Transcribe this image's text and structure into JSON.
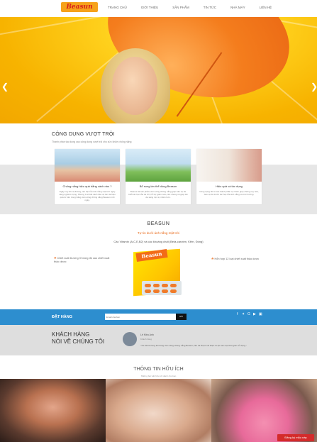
{
  "header": {
    "logo": "Beasun",
    "nav": [
      "TRANG CHỦ",
      "GIỚI THIỆU",
      "SẢN PHẨM",
      "TIN TỨC",
      "NHÀ MÁY",
      "LIÊN HỆ"
    ]
  },
  "hero": {
    "prev_icon": "chevron-left-icon",
    "next_icon": "chevron-right-icon"
  },
  "benefits": {
    "title": "CÔNG DỤNG VƯỢT TRỘI",
    "subtitle": "Thành phần tác dụng cao công dụng vượt trội cho sức khỏe chống nắng",
    "cards": [
      {
        "title": "Chống nắng hiệu quả bằng cách nào ?",
        "body": "Ngày nay khi ra đường, tác hại của ánh nắng mặt trời ngày càng nghiêm trọng. Nhưng ít ai biết cách bảo vệ làn da hiệu quả từ bên trong bằng viên uống chống nắng Beasun mỗi ngày."
      },
      {
        "title": "Bổ sung làn thể dùng Beasun",
        "body": "Beasun là sản phẩm viên uống chống nắng giúp bảo vệ da khỏi tác hại của tia UV, hỗ trợ giảm nám, tàn nhang và giúp làn da sáng mịn tự nhiên hơn."
      },
      {
        "title": "Hiệu quả và tác dụng",
        "body": "Công dụng tốt từ các thành phần tự nhiên giúp chống oxy hóa, bảo vệ da trước tác hại của ánh nắng và môi trường."
      }
    ]
  },
  "product": {
    "title": "BEASUN",
    "subtitle": "Tự tin dưới ánh nắng mặt trời",
    "desc": "Các Vitamin (A,C,E,B2) và các khoáng chất (Beta-caroten, Kẽm, Đồng)",
    "left_feature": "Chiết xuất Dương Xỉ nồng độ cao chiết xuất thảo dược",
    "right_feature": "Hỗn hợp 12 loại chiết xuất thảo dược",
    "box_logo": "Beasun"
  },
  "order": {
    "label": "ĐẶT HÀNG",
    "placeholder": "Email của bạn",
    "button": "Gửi"
  },
  "testimonials": {
    "title_line1": "KHÁCH HÀNG",
    "title_line2": "NÓI VỀ CHÚNG TÔI",
    "name": "Lê Kiều Anh",
    "role": "Khách hàng",
    "quote": "\"Tôi rất hài lòng khi dùng viên uống chống nắng Beasun, làn da được cải thiện rõ rệt sau một thời gian sử dụng.\""
  },
  "info": {
    "title": "THÔNG TIN HỮU ÍCH",
    "subtitle": "Những bài viết hữu ích dành cho bạn"
  },
  "register_button": "Đăng ký mẫu này",
  "colors": {
    "accent": "#2d8ecf",
    "orange": "#e86a1a",
    "register": "#d42b2b"
  }
}
